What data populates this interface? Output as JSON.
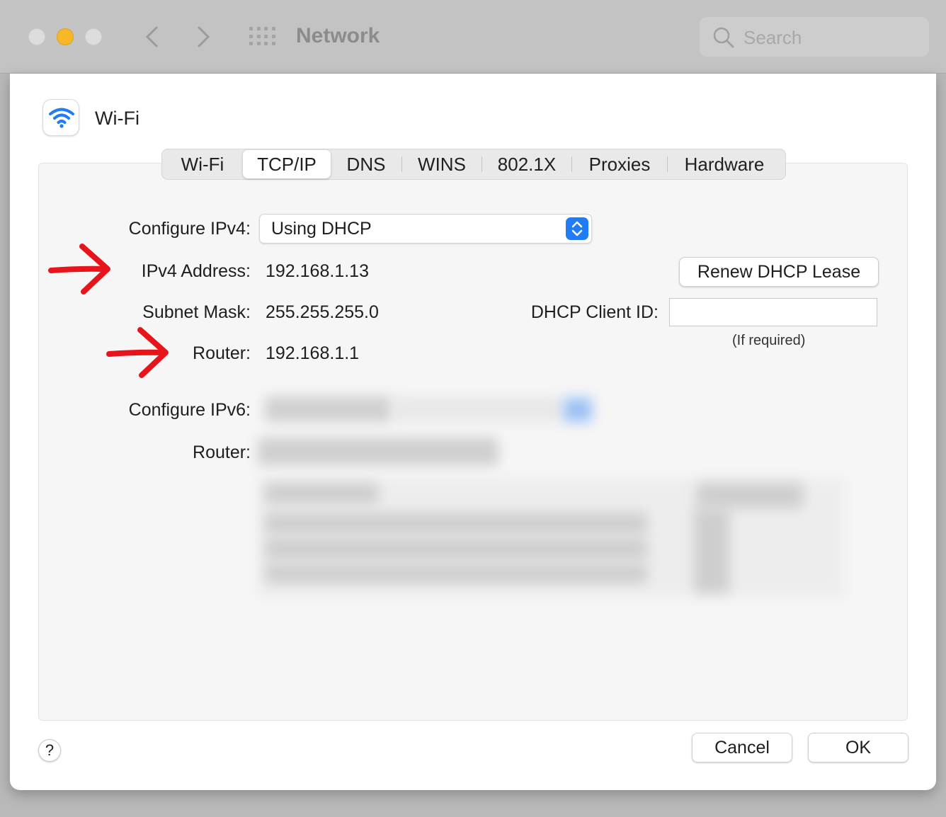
{
  "window": {
    "title": "Network"
  },
  "search": {
    "placeholder": "Search"
  },
  "interface": {
    "name": "Wi-Fi"
  },
  "tabs": [
    {
      "label": "Wi-Fi",
      "active": false
    },
    {
      "label": "TCP/IP",
      "active": true
    },
    {
      "label": "DNS",
      "active": false
    },
    {
      "label": "WINS",
      "active": false
    },
    {
      "label": "802.1X",
      "active": false
    },
    {
      "label": "Proxies",
      "active": false
    },
    {
      "label": "Hardware",
      "active": false
    }
  ],
  "ipv4": {
    "configure_label": "Configure IPv4:",
    "configure_value": "Using DHCP",
    "address_label": "IPv4 Address:",
    "address_value": "192.168.1.13",
    "subnet_label": "Subnet Mask:",
    "subnet_value": "255.255.255.0",
    "router_label": "Router:",
    "router_value": "192.168.1.1"
  },
  "dhcp": {
    "renew_label": "Renew DHCP Lease",
    "client_id_label": "DHCP Client ID:",
    "client_id_value": "",
    "client_id_hint": "(If required)"
  },
  "ipv6": {
    "configure_label": "Configure IPv6:",
    "router_label": "Router:"
  },
  "footer": {
    "help_label": "?",
    "cancel_label": "Cancel",
    "ok_label": "OK"
  },
  "colors": {
    "accent": "#1f7bf6",
    "annotation_arrow": "#e8141c",
    "close_light": "#dcdcdc",
    "minimize_light": "#f6b728"
  }
}
